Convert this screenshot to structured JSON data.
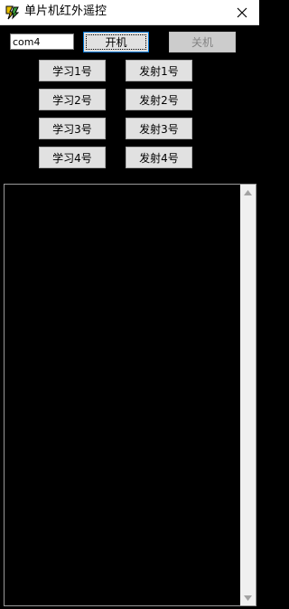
{
  "window": {
    "title": "单片机红外遥控",
    "icon": "app-icon",
    "close_icon": "close-icon"
  },
  "controls": {
    "port_value": "com4",
    "open_label": "开机",
    "close_label": "关机"
  },
  "learn_buttons": [
    "学习1号",
    "学习2号",
    "学习3号",
    "学习4号"
  ],
  "send_buttons": [
    "发射1号",
    "发射2号",
    "发射3号",
    "发射4号"
  ],
  "log": {
    "text": ""
  },
  "colors": {
    "client_background": "#000000",
    "button_face": "#e1e1e1",
    "focus_border": "#0078d7"
  }
}
